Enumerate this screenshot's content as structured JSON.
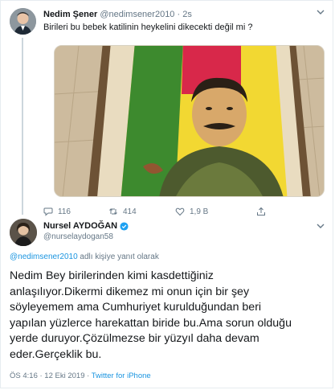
{
  "original_tweet": {
    "author_name": "Nedim Şener",
    "author_handle": "@nedimsener2010",
    "separator": "·",
    "time": "2s",
    "text": "Birileri bu bebek katilinin heykelini dikecekti değil mi ?",
    "actions": {
      "reply_count": "116",
      "retweet_count": "414",
      "like_count": "1,9 B"
    }
  },
  "reply_tweet": {
    "author_name": "Nursel AYDOĞAN",
    "author_handle": "@nurselaydogan58",
    "replying_to_handle": "@nedimsener2010",
    "replying_to_suffix": " adlı kişiye yanıt olarak",
    "text": "Nedim Bey birilerinden kimi kasdettiğiniz\nanlaşılıyor.Dikermi dikemez mi onun için bir şey\nsöyleyemem ama Cumhuriyet kurulduğundan beri\nyapılan yüzlerce harekattan biride bu.Ama sorun olduğu\nyerde duruyor.Çözülmezse bir yüzyıl daha devam\neder.Gerçeklik bu.",
    "timestamp": "ÖS 4:16 · 12 Eki 2019 · ",
    "source": "Twitter for iPhone"
  },
  "colors": {
    "link": "#1b95e0",
    "muted": "#657786",
    "verified": "#1da1f2"
  },
  "icons": {
    "reply": "reply-icon",
    "retweet": "retweet-icon",
    "like": "heart-icon",
    "share": "share-icon",
    "more": "chevron-down-icon",
    "verified": "verified-badge-icon"
  }
}
